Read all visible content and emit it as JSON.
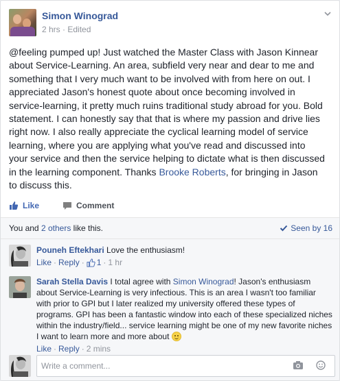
{
  "post": {
    "author": "Simon Winograd",
    "time": "2 hrs",
    "dot": "·",
    "edited": "Edited",
    "text_parts": {
      "before_link": "@feeling pumped up! Just watched the Master Class with Jason Kinnear about Service-Learning. An area, subfield very near and dear to me and something that I very much want to be involved with from here on out. I appreciated Jason's honest quote about once becoming involved in service-learning, it pretty much ruins traditional study abroad for you. Bold statement. I can honestly say that that is where my passion and drive lies right now. I also really appreciate the cyclical learning model of service learning, where you are applying what you've read and discussed into your service and then the service helping to dictate what is then discussed in the learning component. Thanks ",
      "link": "Brooke Roberts",
      "after_link": ", for bringing in Jason to discuss this."
    }
  },
  "actions": {
    "like": "Like",
    "comment": "Comment"
  },
  "likes": {
    "prefix": "You and ",
    "others": "2 others",
    "suffix": " like this.",
    "seen_by": "Seen by 16"
  },
  "comments": [
    {
      "author": "Pouneh Eftekhari",
      "text": "Love the enthusiasm!",
      "like": "Like",
      "reply": "Reply",
      "like_count": "1",
      "time": "1 hr"
    },
    {
      "author": "Sarah Stella Davis",
      "text_before": "I total agree with ",
      "mention": "Simon Winograd",
      "text_after": "! Jason's enthusiasm about Service-Learning is very infectious. This is an area I wasn't too familiar with prior to GPI but I later realized my university offered these types of programs. GPI has been a fantastic window into each of these specialized niches within the industry/field... service learning might be one of my new favorite niches I want to learn more and more about ",
      "like": "Like",
      "reply": "Reply",
      "time": "2 mins"
    }
  ],
  "composer": {
    "placeholder": "Write a comment..."
  },
  "colors": {
    "link": "#365899",
    "like_blue": "#4267b2",
    "meta_gray": "#90949c"
  },
  "icons": [
    "chevron-down-icon",
    "thumbs-up-icon",
    "comment-icon",
    "checkmark-icon",
    "smiley-emoji-icon",
    "camera-icon",
    "emoji-picker-icon"
  ]
}
